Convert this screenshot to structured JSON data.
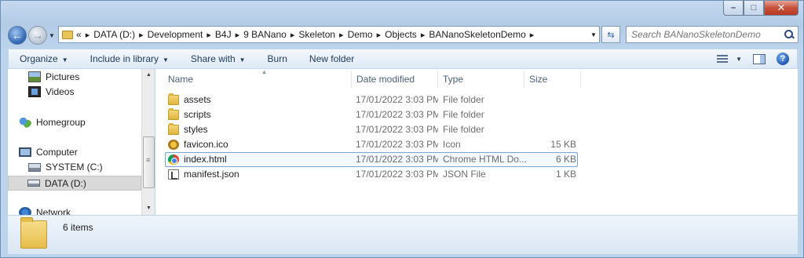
{
  "window": {
    "caption": {
      "minimize": "–",
      "maximize": "□",
      "close": "✕"
    }
  },
  "address": {
    "overflow": "«",
    "crumbs": [
      "DATA (D:)",
      "Development",
      "B4J",
      "9 BANano",
      "Skeleton",
      "Demo",
      "Objects",
      "BANanoSkeletonDemo"
    ]
  },
  "search": {
    "placeholder": "Search BANanoSkeletonDemo"
  },
  "toolbar": {
    "organize": "Organize",
    "include_in_library": "Include in library",
    "share_with": "Share with",
    "burn": "Burn",
    "new_folder": "New folder"
  },
  "nav": {
    "items": [
      {
        "label": "Pictures",
        "icon": "pictures-icon"
      },
      {
        "label": "Videos",
        "icon": "videos-icon"
      },
      {
        "label": "Homegroup",
        "icon": "homegroup-icon"
      },
      {
        "label": "Computer",
        "icon": "computer-icon"
      },
      {
        "label": "SYSTEM (C:)",
        "icon": "system-drive-icon"
      },
      {
        "label": "DATA (D:)",
        "icon": "drive-icon",
        "selected": true
      },
      {
        "label": "Network",
        "icon": "network-icon"
      }
    ]
  },
  "columns": {
    "name": "Name",
    "date": "Date modified",
    "type": "Type",
    "size": "Size"
  },
  "files": [
    {
      "name": "assets",
      "date": "17/01/2022 3:03 PM",
      "type": "File folder",
      "size": "",
      "icon": "folder-icon"
    },
    {
      "name": "scripts",
      "date": "17/01/2022 3:03 PM",
      "type": "File folder",
      "size": "",
      "icon": "folder-icon"
    },
    {
      "name": "styles",
      "date": "17/01/2022 3:03 PM",
      "type": "File folder",
      "size": "",
      "icon": "folder-icon"
    },
    {
      "name": "favicon.ico",
      "date": "17/01/2022 3:03 PM",
      "type": "Icon",
      "size": "15 KB",
      "icon": "ico-file-icon"
    },
    {
      "name": "index.html",
      "date": "17/01/2022 3:03 PM",
      "type": "Chrome HTML Do...",
      "size": "6 KB",
      "icon": "chrome-html-icon",
      "selected": true
    },
    {
      "name": "manifest.json",
      "date": "17/01/2022 3:03 PM",
      "type": "JSON File",
      "size": "1 KB",
      "icon": "json-file-icon"
    }
  ],
  "details": {
    "item_count": "6 items"
  }
}
